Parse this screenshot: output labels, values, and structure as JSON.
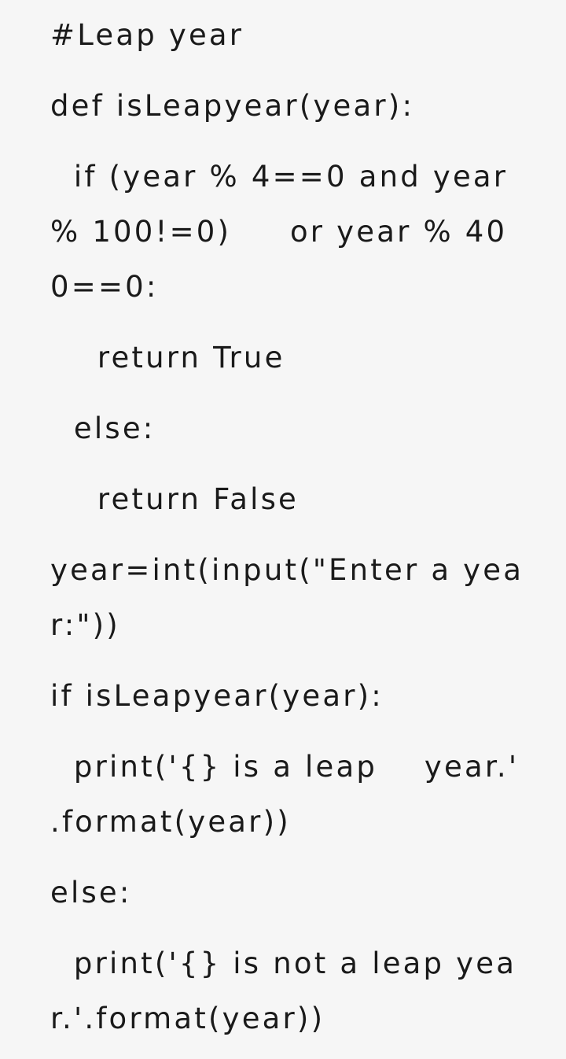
{
  "lines": [
    "#Leap year",
    "def isLeapyear(year):",
    "  if (year % 4==0 and year",
    "% 100!=0)     or year % 40",
    "0==0:",
    "    return True",
    "  else:",
    "    return False",
    "year=int(input(\"Enter a yea",
    "r:\"))",
    "if isLeapyear(year):",
    "  print('{} is a leap    year.'",
    ".format(year))",
    "else:",
    "  print('{} is not a leap yea",
    "r.'.format(year))"
  ]
}
